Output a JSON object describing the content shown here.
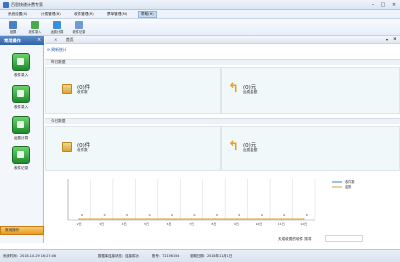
{
  "window": {
    "title": "百思快递计费专家"
  },
  "menu": [
    "系统设置(S)",
    "计费管理(B)",
    "收件管理(R)",
    "票单管理(M)",
    "帮助(H)"
  ],
  "toolbar": [
    {
      "label": "锁屏",
      "color": "#4a7fc6"
    },
    {
      "label": "收件录入",
      "color": "#4aa84e"
    },
    {
      "label": "运费计算",
      "color": "#3b8fd8"
    },
    {
      "label": "收件记录",
      "color": "#6f9bd0"
    }
  ],
  "sidebar": {
    "title": "常用操作",
    "items": [
      "收件录入",
      "收件录入",
      "运费计算",
      "收件记录"
    ],
    "footer": "常用操作"
  },
  "panel": {
    "tab": "首页",
    "refresh": "刷新统计"
  },
  "sections": [
    {
      "label": "昨日数据",
      "count": "(0)件",
      "count_label": "收件数",
      "amount": "(0)元",
      "amount_label": "运费金额"
    },
    {
      "label": "今日数据",
      "count": "(0)件",
      "count_label": "收件数",
      "amount": "(0)元",
      "amount_label": "运费金额"
    }
  ],
  "chart_data": {
    "type": "line",
    "categories": [
      "2日",
      "3日",
      "4日",
      "5日",
      "6日",
      "7日",
      "8日",
      "9日",
      "10日",
      "11日",
      "12日"
    ],
    "series": [
      {
        "name": "收件数",
        "color": "#3c7fd1",
        "values": [
          0,
          0,
          0,
          0,
          0,
          0,
          0,
          0,
          0,
          0,
          0
        ]
      },
      {
        "name": "金额",
        "color": "#e0a030",
        "values": [
          0,
          0,
          0,
          0,
          0,
          0,
          0,
          0,
          0,
          0,
          0
        ]
      }
    ],
    "data_labels": "0"
  },
  "filter": {
    "label": "天成收费的软件 搜寻"
  },
  "status": {
    "time": "系统时间：2018-10-29 16:27:46",
    "db": "数据库连接状态：连接成功",
    "account": "账号：72156154",
    "expiry": "到期日期：2018年11月1日"
  }
}
